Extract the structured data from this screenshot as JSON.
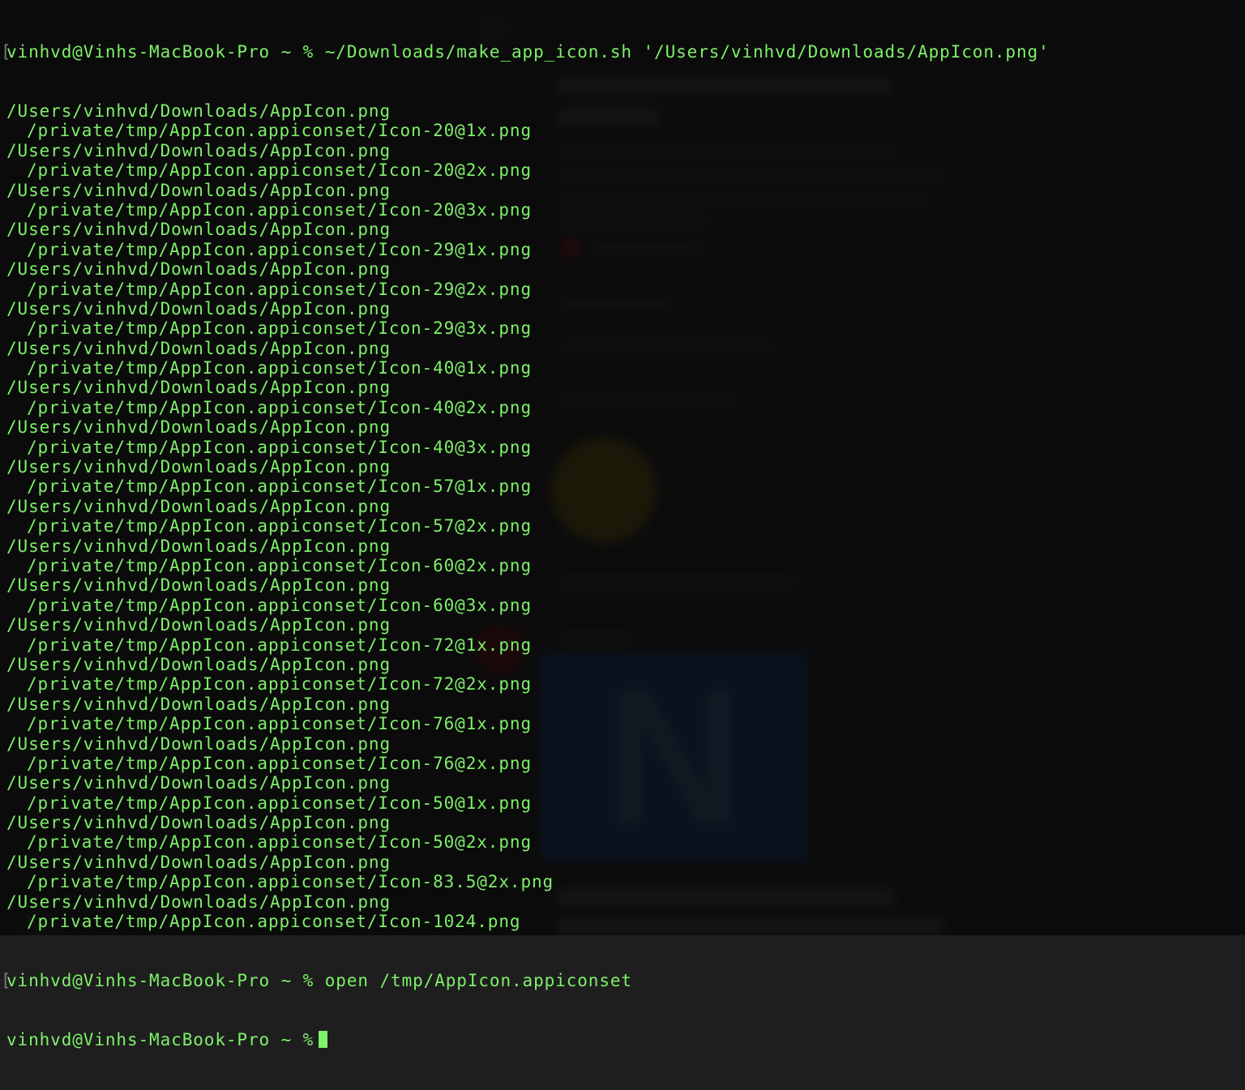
{
  "terminal": {
    "prompt": "vinhvd@Vinhs-MacBook-Pro ~ %",
    "command1": "~/Downloads/make_app_icon.sh '/Users/vinhvd/Downloads/AppIcon.png'",
    "output_pairs": [
      {
        "src": "/Users/vinhvd/Downloads/AppIcon.png",
        "dst": "/private/tmp/AppIcon.appiconset/Icon-20@1x.png"
      },
      {
        "src": "/Users/vinhvd/Downloads/AppIcon.png",
        "dst": "/private/tmp/AppIcon.appiconset/Icon-20@2x.png"
      },
      {
        "src": "/Users/vinhvd/Downloads/AppIcon.png",
        "dst": "/private/tmp/AppIcon.appiconset/Icon-20@3x.png"
      },
      {
        "src": "/Users/vinhvd/Downloads/AppIcon.png",
        "dst": "/private/tmp/AppIcon.appiconset/Icon-29@1x.png"
      },
      {
        "src": "/Users/vinhvd/Downloads/AppIcon.png",
        "dst": "/private/tmp/AppIcon.appiconset/Icon-29@2x.png"
      },
      {
        "src": "/Users/vinhvd/Downloads/AppIcon.png",
        "dst": "/private/tmp/AppIcon.appiconset/Icon-29@3x.png"
      },
      {
        "src": "/Users/vinhvd/Downloads/AppIcon.png",
        "dst": "/private/tmp/AppIcon.appiconset/Icon-40@1x.png"
      },
      {
        "src": "/Users/vinhvd/Downloads/AppIcon.png",
        "dst": "/private/tmp/AppIcon.appiconset/Icon-40@2x.png"
      },
      {
        "src": "/Users/vinhvd/Downloads/AppIcon.png",
        "dst": "/private/tmp/AppIcon.appiconset/Icon-40@3x.png"
      },
      {
        "src": "/Users/vinhvd/Downloads/AppIcon.png",
        "dst": "/private/tmp/AppIcon.appiconset/Icon-57@1x.png"
      },
      {
        "src": "/Users/vinhvd/Downloads/AppIcon.png",
        "dst": "/private/tmp/AppIcon.appiconset/Icon-57@2x.png"
      },
      {
        "src": "/Users/vinhvd/Downloads/AppIcon.png",
        "dst": "/private/tmp/AppIcon.appiconset/Icon-60@2x.png"
      },
      {
        "src": "/Users/vinhvd/Downloads/AppIcon.png",
        "dst": "/private/tmp/AppIcon.appiconset/Icon-60@3x.png"
      },
      {
        "src": "/Users/vinhvd/Downloads/AppIcon.png",
        "dst": "/private/tmp/AppIcon.appiconset/Icon-72@1x.png"
      },
      {
        "src": "/Users/vinhvd/Downloads/AppIcon.png",
        "dst": "/private/tmp/AppIcon.appiconset/Icon-72@2x.png"
      },
      {
        "src": "/Users/vinhvd/Downloads/AppIcon.png",
        "dst": "/private/tmp/AppIcon.appiconset/Icon-76@1x.png"
      },
      {
        "src": "/Users/vinhvd/Downloads/AppIcon.png",
        "dst": "/private/tmp/AppIcon.appiconset/Icon-76@2x.png"
      },
      {
        "src": "/Users/vinhvd/Downloads/AppIcon.png",
        "dst": "/private/tmp/AppIcon.appiconset/Icon-50@1x.png"
      },
      {
        "src": "/Users/vinhvd/Downloads/AppIcon.png",
        "dst": "/private/tmp/AppIcon.appiconset/Icon-50@2x.png"
      },
      {
        "src": "/Users/vinhvd/Downloads/AppIcon.png",
        "dst": "/private/tmp/AppIcon.appiconset/Icon-83.5@2x.png"
      },
      {
        "src": "/Users/vinhvd/Downloads/AppIcon.png",
        "dst": "/private/tmp/AppIcon.appiconset/Icon-1024.png"
      }
    ],
    "command2": "open /tmp/AppIcon.appiconset",
    "colors": {
      "text": "#7ef06a",
      "background": "#000000"
    }
  },
  "background_window": {
    "big_letter": "N"
  }
}
